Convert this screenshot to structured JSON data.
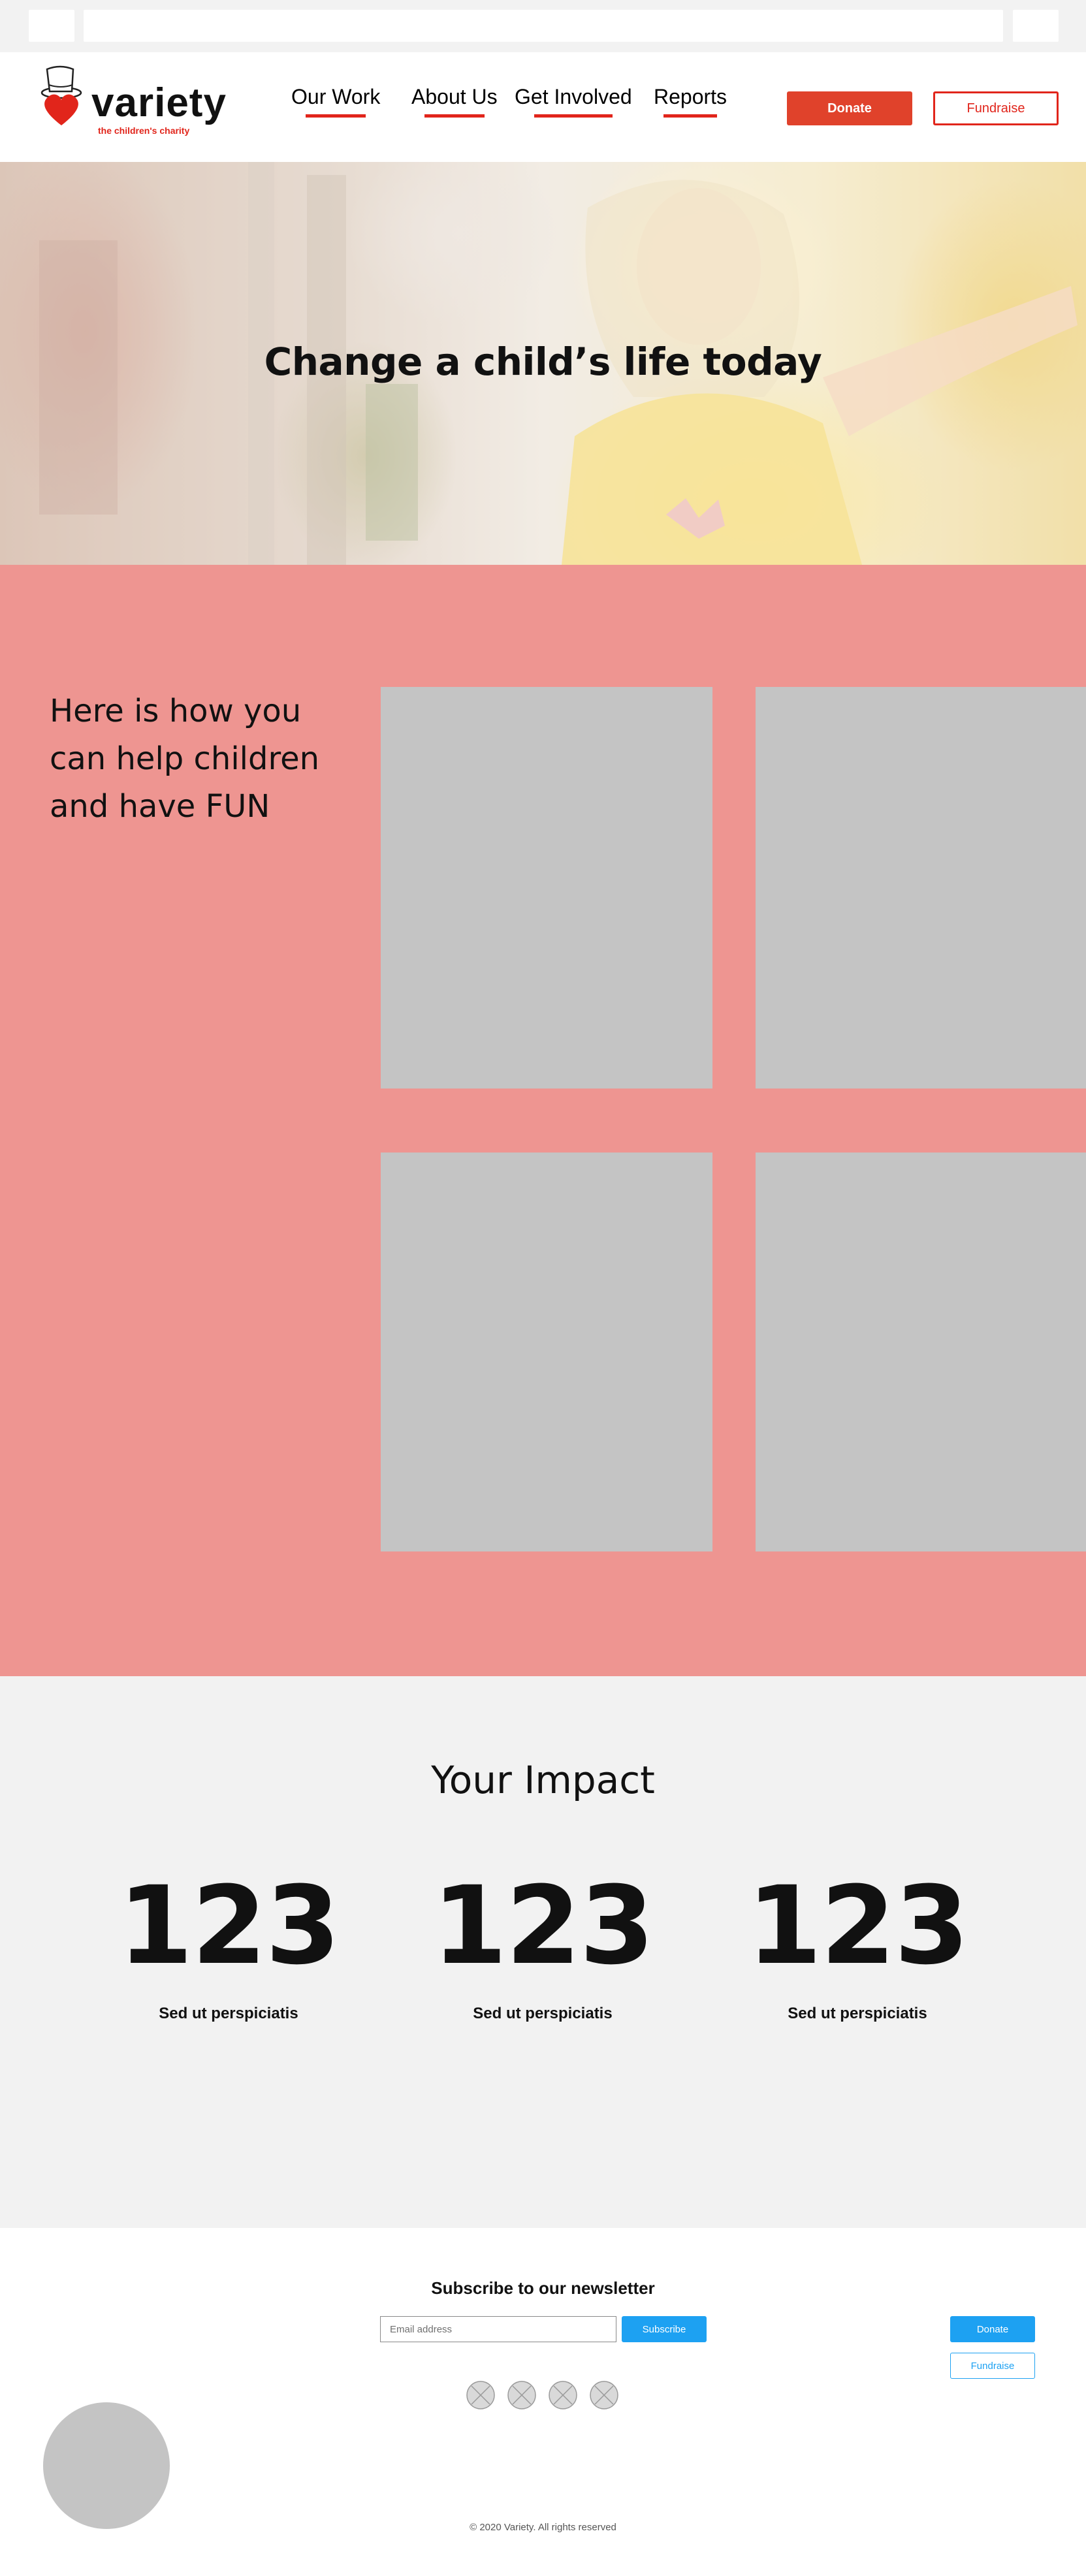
{
  "header": {
    "logo_word": "variety",
    "logo_tagline": "the children's charity",
    "nav": [
      "Our Work",
      "About Us",
      "Get Involved",
      "Reports"
    ],
    "donate_label": "Donate",
    "fundraise_label": "Fundraise"
  },
  "hero": {
    "title": "Change a child’s life today"
  },
  "help": {
    "title": "Here is how you can help children and have FUN"
  },
  "impact": {
    "title": "Your Impact",
    "stats": [
      {
        "value": "123",
        "caption": "Sed ut perspiciatis"
      },
      {
        "value": "123",
        "caption": "Sed ut perspiciatis"
      },
      {
        "value": "123",
        "caption": "Sed ut perspiciatis"
      }
    ]
  },
  "footer": {
    "newsletter_title": "Subscribe to our newsletter",
    "email_placeholder": "Email address",
    "subscribe_label": "Subscribe",
    "donate_label": "Donate",
    "fundraise_label": "Fundraise",
    "copyright": "© 2020 Variety. All rights reserved",
    "social_icons": [
      "social-icon",
      "social-icon",
      "social-icon",
      "social-icon"
    ]
  },
  "colors": {
    "brand_red": "#e1251b",
    "help_bg": "#ee9591",
    "impact_bg": "#f2f2f2",
    "footer_blue": "#1da1f2",
    "placeholder_grey": "#c4c4c4"
  }
}
